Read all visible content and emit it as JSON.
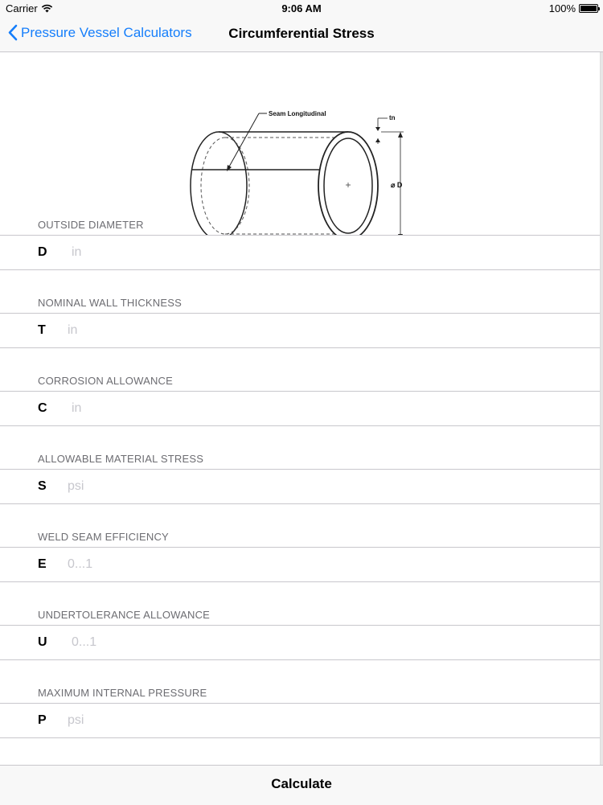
{
  "status_bar": {
    "carrier": "Carrier",
    "time": "9:06 AM",
    "battery": "100%"
  },
  "nav": {
    "back_label": "Pressure Vessel Calculators",
    "title": "Circumferential Stress"
  },
  "diagram": {
    "seam_label": "Seam Longitudinal",
    "thickness_label": "tn",
    "diameter_label": "⌀ D"
  },
  "fields": [
    {
      "header": "OUTSIDE DIAMETER",
      "label": "D",
      "placeholder": "in",
      "value": ""
    },
    {
      "header": "NOMINAL WALL THICKNESS",
      "label": "T",
      "placeholder": "in",
      "value": ""
    },
    {
      "header": "CORROSION ALLOWANCE",
      "label": "C",
      "placeholder": "in",
      "value": ""
    },
    {
      "header": "ALLOWABLE MATERIAL STRESS",
      "label": "S",
      "placeholder": "psi",
      "value": ""
    },
    {
      "header": "WELD SEAM EFFICIENCY",
      "label": "E",
      "placeholder": "0...1",
      "value": ""
    },
    {
      "header": "UNDERTOLERANCE ALLOWANCE",
      "label": "U",
      "placeholder": "0...1",
      "value": ""
    },
    {
      "header": "MAXIMUM INTERNAL PRESSURE",
      "label": "P",
      "placeholder": "psi",
      "value": ""
    }
  ],
  "actions": {
    "calculate_label": "Calculate"
  },
  "colors": {
    "accent": "#157efb",
    "separator": "#c8c7cc",
    "section_text": "#6d6d72",
    "placeholder": "#c7c7cd"
  }
}
